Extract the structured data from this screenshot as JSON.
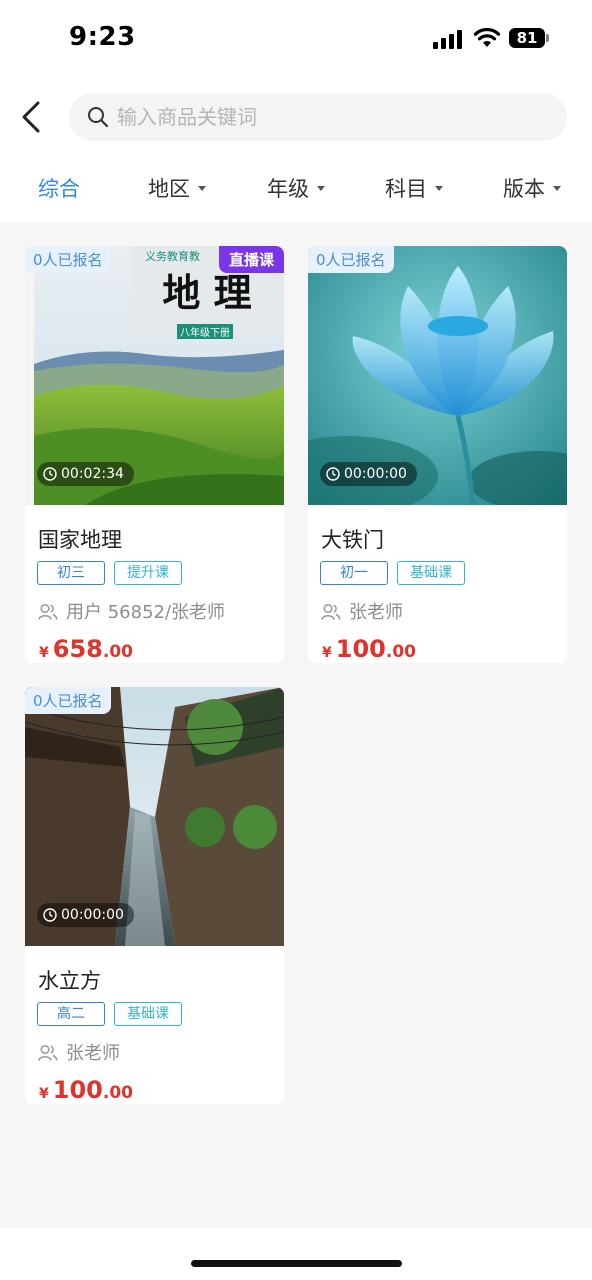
{
  "status": {
    "time": "9:23",
    "battery": "81"
  },
  "search": {
    "placeholder": "输入商品关键词"
  },
  "filters": [
    {
      "label": "综合",
      "active": true
    },
    {
      "label": "地区",
      "dropdown": true
    },
    {
      "label": "年级",
      "dropdown": true
    },
    {
      "label": "科目",
      "dropdown": true
    },
    {
      "label": "版本",
      "dropdown": true
    }
  ],
  "courses": [
    {
      "enrolled": "0人已报名",
      "badge": "直播课",
      "duration": "00:02:34",
      "title": "国家地理",
      "grade": "初三",
      "type": "提升课",
      "teacher": "用户 56852/张老师",
      "price_symbol": "¥",
      "price_int": "658",
      "price_dec": ".00",
      "cover_text": {
        "top": "义务教育教",
        "main": "地 理",
        "sub": "八年级下册"
      }
    },
    {
      "enrolled": "0人已报名",
      "duration": "00:00:00",
      "title": "大铁门",
      "grade": "初一",
      "type": "基础课",
      "teacher": "张老师",
      "price_symbol": "¥",
      "price_int": "100",
      "price_dec": ".00"
    },
    {
      "enrolled": "0人已报名",
      "duration": "00:00:00",
      "title": "水立方",
      "grade": "高二",
      "type": "基础课",
      "teacher": "张老师",
      "price_symbol": "¥",
      "price_int": "100",
      "price_dec": ".00"
    }
  ],
  "colors": {
    "accent": "#2f8ae3",
    "price": "#e0332c",
    "live_badge": "#7b35e8",
    "tag_grade": "#3a80d9",
    "tag_type": "#2fb4d4"
  }
}
